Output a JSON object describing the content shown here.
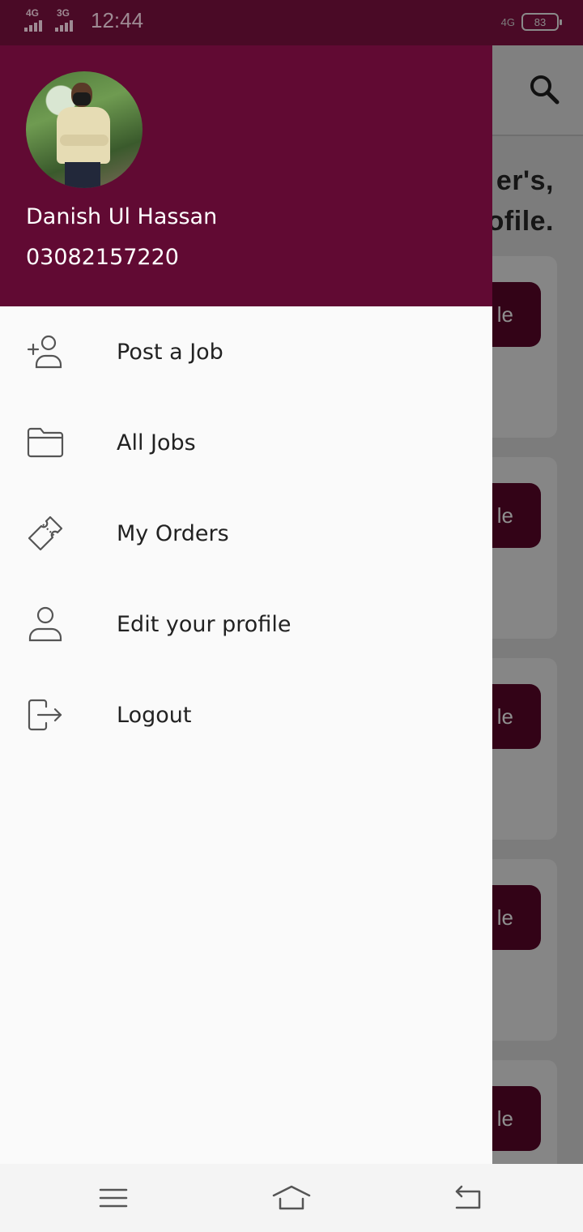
{
  "status_bar": {
    "network_1": "4G",
    "network_2": "3G",
    "time": "12:44",
    "right_network": "4G",
    "battery": "83"
  },
  "app": {
    "heading_line1": "er's,",
    "heading_line2": "rofile.",
    "card_button_label": "le"
  },
  "drawer": {
    "user": {
      "name": "Danish Ul Hassan",
      "phone": "03082157220"
    },
    "menu": [
      {
        "label": "Post a Job",
        "icon": "add-user-icon"
      },
      {
        "label": "All Jobs",
        "icon": "folder-icon"
      },
      {
        "label": "My Orders",
        "icon": "ticket-icon"
      },
      {
        "label": "Edit your profile",
        "icon": "user-icon"
      },
      {
        "label": "Logout",
        "icon": "logout-icon"
      }
    ]
  },
  "colors": {
    "primary": "#610a33",
    "status_bar": "#4a0a26",
    "drawer_bg": "#fafafa",
    "scrim_button": "#330317"
  }
}
